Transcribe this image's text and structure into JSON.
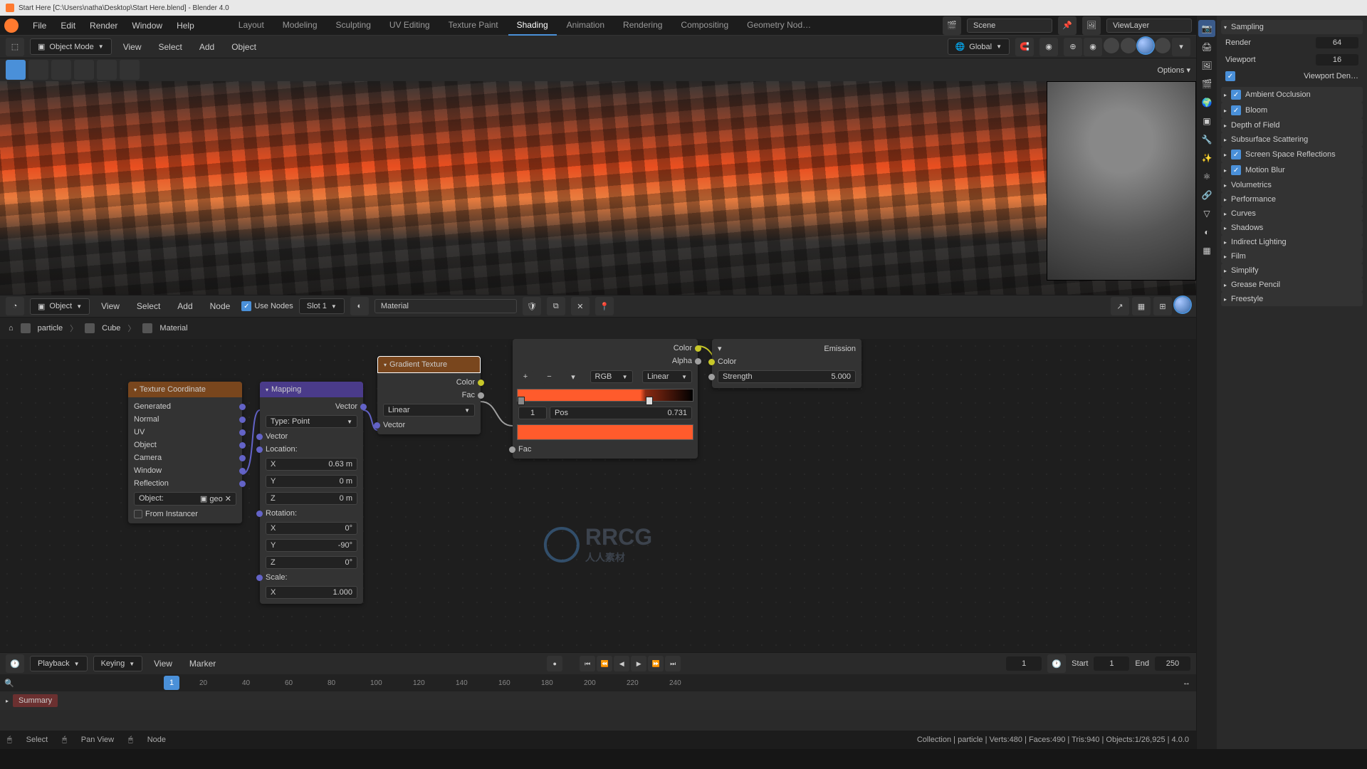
{
  "titlebar": {
    "text": "Start Here  [C:\\Users\\natha\\Desktop\\Start Here.blend] - Blender 4.0"
  },
  "topmenu": {
    "items": [
      "File",
      "Edit",
      "Render",
      "Window",
      "Help"
    ]
  },
  "workspaces": {
    "tabs": [
      "Layout",
      "Modeling",
      "Sculpting",
      "UV Editing",
      "Texture Paint",
      "Shading",
      "Animation",
      "Rendering",
      "Compositing",
      "Geometry Nod…"
    ],
    "active": 5
  },
  "scene_input": "Scene",
  "viewlayer_input": "ViewLayer",
  "header3d": {
    "mode": "Object Mode",
    "menus": [
      "View",
      "Select",
      "Add",
      "Object"
    ],
    "orientation": "Global",
    "options": "Options"
  },
  "node_header": {
    "mode": "Object",
    "menus": [
      "View",
      "Select",
      "Add",
      "Node"
    ],
    "use_nodes": "Use Nodes",
    "slot": "Slot 1",
    "material": "Material"
  },
  "breadcrumb": {
    "items": [
      "particle",
      "Cube",
      "Material"
    ]
  },
  "nodes": {
    "texcoord": {
      "title": "Texture Coordinate",
      "outputs": [
        "Generated",
        "Normal",
        "UV",
        "Object",
        "Camera",
        "Window",
        "Reflection"
      ],
      "object_label": "Object:",
      "object_val": "geo",
      "from_instancer": "From Instancer"
    },
    "mapping": {
      "title": "Mapping",
      "vector_out": "Vector",
      "type_label": "Type:",
      "type_val": "Point",
      "vector_in": "Vector",
      "location": "Location:",
      "loc": {
        "x_label": "X",
        "x": "0.63 m",
        "y_label": "Y",
        "y": "0 m",
        "z_label": "Z",
        "z": "0 m"
      },
      "rotation": "Rotation:",
      "rot": {
        "x_label": "X",
        "x": "0°",
        "y_label": "Y",
        "y": "-90°",
        "z_label": "Z",
        "z": "0°"
      },
      "scale": "Scale:",
      "scl": {
        "x_label": "X",
        "x": "1.000"
      }
    },
    "gradient": {
      "title": "Gradient Texture",
      "color": "Color",
      "fac": "Fac",
      "type": "Linear",
      "vector": "Vector"
    },
    "colorramp": {
      "color": "Color",
      "alpha": "Alpha",
      "mode": "RGB",
      "interp": "Linear",
      "stop_index": "1",
      "pos_label": "Pos",
      "pos_val": "0.731",
      "fac": "Fac"
    },
    "emission": {
      "title": "Emission",
      "color": "Color",
      "strength_label": "Strength",
      "strength_val": "5.000"
    }
  },
  "timeline": {
    "playback": "Playback",
    "keying": "Keying",
    "menus": [
      "View",
      "Marker"
    ],
    "frame": "1",
    "start_label": "Start",
    "start": "1",
    "end_label": "End",
    "end": "250",
    "ticks": [
      "20",
      "40",
      "60",
      "80",
      "100",
      "120",
      "140",
      "160",
      "180",
      "200",
      "220",
      "240"
    ],
    "cursor": "1",
    "summary": "Summary"
  },
  "statusbar": {
    "select": "Select",
    "pan": "Pan View",
    "node": "Node",
    "stats": "Collection | particle | Verts:480 | Faces:490 | Tris:940 | Objects:1/26,925 | 4.0.0"
  },
  "properties": {
    "sampling": {
      "title": "Sampling",
      "render_label": "Render",
      "render": "64",
      "viewport_label": "Viewport",
      "viewport": "16",
      "vdenoise": "Viewport Den…"
    },
    "panels": [
      {
        "label": "Ambient Occlusion",
        "check": true
      },
      {
        "label": "Bloom",
        "check": true
      },
      {
        "label": "Depth of Field",
        "check": false
      },
      {
        "label": "Subsurface Scattering",
        "check": false
      },
      {
        "label": "Screen Space Reflections",
        "check": true
      },
      {
        "label": "Motion Blur",
        "check": true
      },
      {
        "label": "Volumetrics",
        "check": false
      },
      {
        "label": "Performance",
        "check": false
      },
      {
        "label": "Curves",
        "check": false
      },
      {
        "label": "Shadows",
        "check": false
      },
      {
        "label": "Indirect Lighting",
        "check": false
      },
      {
        "label": "Film",
        "check": false
      },
      {
        "label": "Simplify",
        "check": false
      },
      {
        "label": "Grease Pencil",
        "check": false
      },
      {
        "label": "Freestyle",
        "check": false
      }
    ]
  },
  "watermark": {
    "text": "RRCG",
    "sub": "人人素材"
  }
}
